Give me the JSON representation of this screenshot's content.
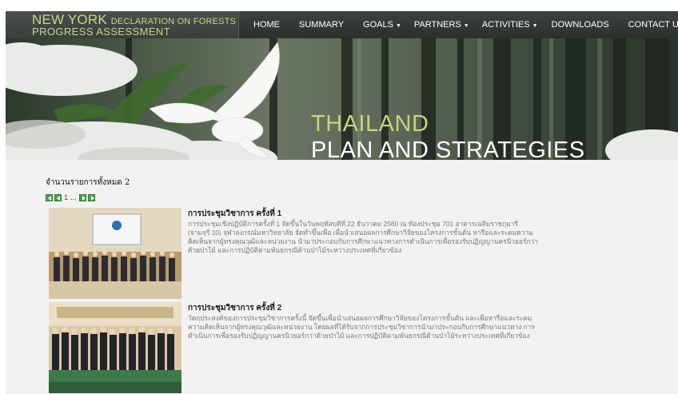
{
  "header": {
    "logo_line1_main": "NEW YORK ",
    "logo_line1_small": "DECLARATION ON FORESTS",
    "logo_line2": "PROGRESS ASSESSMENT"
  },
  "nav": {
    "items": [
      {
        "label": "HOME"
      },
      {
        "label": "SUMMARY"
      },
      {
        "label": "GOALS"
      },
      {
        "label": "PARTNERS"
      },
      {
        "label": "ACTIVITIES"
      },
      {
        "label": "DOWNLOADS"
      },
      {
        "label": "CONTACT US"
      }
    ]
  },
  "banner": {
    "line1": "THAILAND",
    "line2": "PLAN AND STRATEGIES"
  },
  "content": {
    "count_text": "จำนวนรายการทั้งหมด 2",
    "pager": {
      "current": "1",
      "ellipsis": "..."
    },
    "items": [
      {
        "title": "การประชุมวิชาการ ครั้งที่ 1",
        "description": "การประชุมเชิงปฏิบัติการครั้งที่ 1 จัดขึ้นในวันพฤหัสบดีที่ 22 ธันวาคม 2560 ณ ห้องประชุม 701 อาคารเฉลิมราชกุมารี (จามจุรี 10) จุฬาลงกรณ์มหาวิทยาลัย จัดทำขึ้นเพื่อ เพื่อนำเสนอผลการศึกษาวิจัยของโครงการขั้นต้น หารือและระดมความคิดเห็นจากผู้ทรงคุณวุฒิและหน่วยงาน นำมาประกอบกับการศึกษาแนวทางการดำเนินการเพื่อรองรับปฏิญญานครนิวยอร์กว่าด้วยป่าไม้ และการปฏิบัติตามพันธกรณีด้านป่าไม้ระหว่างประเทศที่เกี่ยวข้อง"
      },
      {
        "title": "การประชุมวิชาการ ครั้งที่ 2",
        "description": "วัตถุประสงค์ของการประชุมวิชาการครั้งนี้ จัดขึ้นเพื่อนำเสนอผลการศึกษาวิจัยของโครงการขั้นต้น และเพื่อหารือและระดมความคิดเห็นจากผู้ทรงคุณวุฒิและหน่วยงาน โดยผลที่ได้รับจากการประชุมวิชาการนำมาประกอบกับการศึกษาแนวทาง การดำเนินการเพื่อรองรับปฏิญญานครนิวยอร์กว่าด้วยป่าไม้ และการปฏิบัติตามพันธกรณีด้านป่าไม้ระหว่างประเทศที่เกี่ยวข้อง"
      }
    ]
  },
  "colors": {
    "nav_bg": "#2f3330",
    "logo_text": "#c8d58a",
    "banner_accent": "#c6d47a",
    "pager_green": "#49a34a",
    "pager_current": "#c21f1f"
  }
}
